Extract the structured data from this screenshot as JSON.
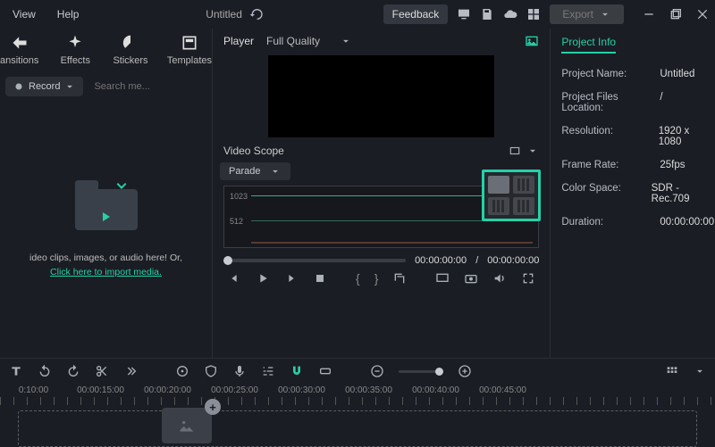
{
  "menu": {
    "view": "View",
    "help": "Help"
  },
  "title": "Untitled",
  "feedback": "Feedback",
  "export": "Export",
  "tools": {
    "transitions": "ansitions",
    "effects": "Effects",
    "stickers": "Stickers",
    "templates": "Templates"
  },
  "record": "Record",
  "search_placeholder": "Search me...",
  "drop_text1": "ideo clips, images, or audio here! Or,",
  "drop_link": "Click here to import media.",
  "player": {
    "label": "Player",
    "quality": "Full Quality"
  },
  "scope": {
    "title": "Video Scope",
    "mode": "Parade",
    "l1": "1023",
    "l2": "512"
  },
  "time": {
    "current": "00:00:00:00",
    "sep": "/",
    "total": "00:00:00:00"
  },
  "project_info": {
    "title": "Project Info",
    "rows": [
      {
        "label": "Project Name:",
        "val": "Untitled"
      },
      {
        "label": "Project Files Location:",
        "val": "/"
      },
      {
        "label": "Resolution:",
        "val": "1920 x 1080"
      },
      {
        "label": "Frame Rate:",
        "val": "25fps"
      },
      {
        "label": "Color Space:",
        "val": "SDR - Rec.709"
      },
      {
        "label": "Duration:",
        "val": "00:00:00:00"
      }
    ]
  },
  "ruler": [
    "0:10:00",
    "00:00:15:00",
    "00:00:20:00",
    "00:00:25:00",
    "00:00:30:00",
    "00:00:35:00",
    "00:00:40:00",
    "00:00:45:00"
  ]
}
